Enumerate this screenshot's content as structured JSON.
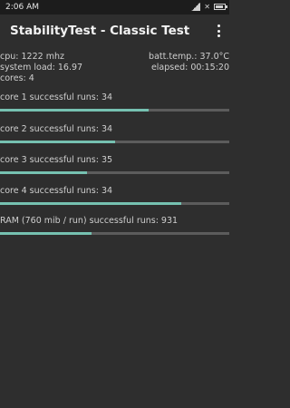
{
  "status_bar": {
    "time": "2:06 AM"
  },
  "app_bar": {
    "title": "StabilityTest - Classic Test"
  },
  "stats": {
    "cpu": "cpu: 1222 mhz",
    "batt_temp": "batt.temp.: 37.0°C",
    "system_load": "system load: 16.97",
    "elapsed": "elapsed: 00:15:20",
    "cores": "cores: 4"
  },
  "progress_items": [
    {
      "label": "core 1 successful runs: 34",
      "fraction": 0.65
    },
    {
      "label": "core 2 successful runs: 34",
      "fraction": 0.5
    },
    {
      "label": "core 3 successful runs: 35",
      "fraction": 0.38
    },
    {
      "label": "core 4 successful runs: 34",
      "fraction": 0.79
    },
    {
      "label": "RAM (760 mib / run) successful runs: 931",
      "fraction": 0.4
    }
  ],
  "colors": {
    "accent": "#76c1b1",
    "track": "#5c5c5c",
    "background": "#2e2e2e"
  }
}
